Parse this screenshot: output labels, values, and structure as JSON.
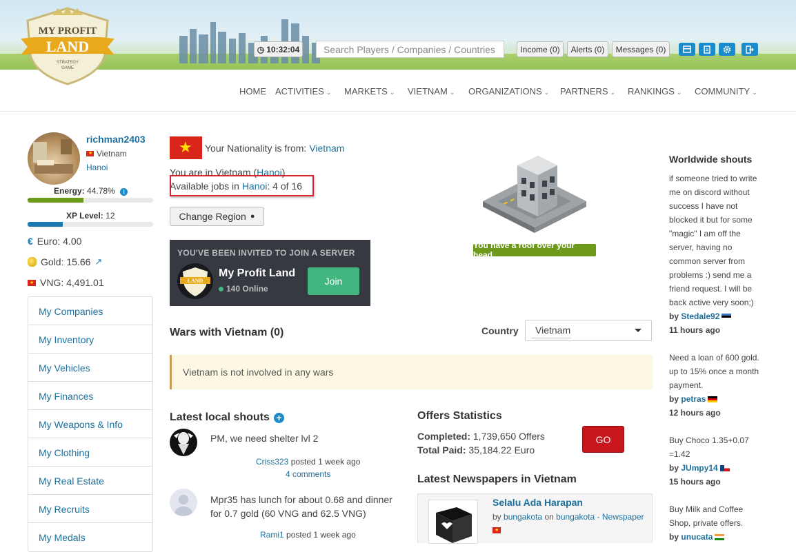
{
  "header": {
    "logo_text": [
      "MY PROFIT",
      "LAND",
      "STRATEGY",
      "GAME"
    ],
    "clock": "10:32:04",
    "search_placeholder": "Search Players / Companies / Countries",
    "income": "Income (0)",
    "alerts": "Alerts (0)",
    "messages": "Messages (0)"
  },
  "nav": [
    "HOME",
    "ACTIVITIES",
    "MARKETS",
    "VIETNAM",
    "ORGANIZATIONS",
    "PARTNERS",
    "RANKINGS",
    "COMMUNITY"
  ],
  "profile": {
    "username": "richman2403",
    "country": "Vietnam",
    "city": "Hanoi",
    "energy_label": "Energy:",
    "energy_value": "44.78%",
    "energy_fraction": 0.4478,
    "xp_label": "XP Level:",
    "xp_value": "12",
    "xp_fraction": 0.28,
    "euro": "Euro: 4.00",
    "gold": "Gold: 15.66",
    "vng": "VNG: 4,491.01"
  },
  "menu": [
    "My Companies",
    "My Inventory",
    "My Vehicles",
    "My Finances",
    "My Weapons & Info",
    "My Clothing",
    "My Real Estate",
    "My Recruits",
    "My Medals"
  ],
  "location": {
    "nationality_prefix": "Your Nationality is from:",
    "nationality": "Vietnam",
    "in_prefix": "You are in Vietnam (",
    "in_city": "Hanoi",
    "in_suffix": ")",
    "jobs_prefix": "Available jobs in",
    "jobs_city": "Hanoi",
    "jobs_count": ": 4 of 16",
    "change_region": "Change Region",
    "roof": "You have a roof over your head"
  },
  "invite": {
    "header": "YOU'VE BEEN INVITED TO JOIN A SERVER",
    "server": "My Profit Land",
    "online": "140 Online",
    "join": "Join"
  },
  "wars": {
    "title": "Wars with Vietnam (0)",
    "country_label": "Country",
    "country_value": "Vietnam",
    "message": "Vietnam is not involved in any wars"
  },
  "shouts": {
    "title": "Latest local shouts",
    "items": [
      {
        "text": "PM, we need shelter lvl 2",
        "author": "Criss323",
        "time": "posted 1 week ago",
        "comments": "4 comments"
      },
      {
        "text": "Mpr35 has lunch for about 0.68 and dinner for 0.7 gold (60 VNG and 62.5 VNG)",
        "author": "Rami1",
        "time": "posted 1 week ago"
      }
    ]
  },
  "offers": {
    "title": "Offers Statistics",
    "completed_label": "Completed:",
    "completed": "1,739,650 Offers",
    "paid_label": "Total Paid:",
    "paid": "35,184.22 Euro",
    "go": "GO",
    "news_title": "Latest Newspapers in Vietnam",
    "paper_name": "Selalu Ada Harapan",
    "paper_by": "by",
    "paper_author": "bungakota",
    "paper_on": "on",
    "paper_link": "bungakota - Newspaper"
  },
  "worldwide": {
    "title": "Worldwide shouts",
    "items": [
      {
        "text": "if someone tried to write me on discord without success I have not blocked it but for some \"magic\" I am off the server, having no common server from problems :) send me a friend request. I will be back active very soon;)",
        "by": "by",
        "user": "Stedale92",
        "time": "11 hours ago"
      },
      {
        "text": "Need a loan of 600 gold. up to 15% once a month payment.",
        "by": "by",
        "user": "petras",
        "time": "12 hours ago"
      },
      {
        "text": "Buy Choco 1.35+0.07 =1.42",
        "by": "by",
        "user": "JUmpy14",
        "time": "15 hours ago"
      },
      {
        "text": "Buy Milk and Coffee Shop, private offers.",
        "by": "by",
        "user": "unucata"
      }
    ]
  }
}
